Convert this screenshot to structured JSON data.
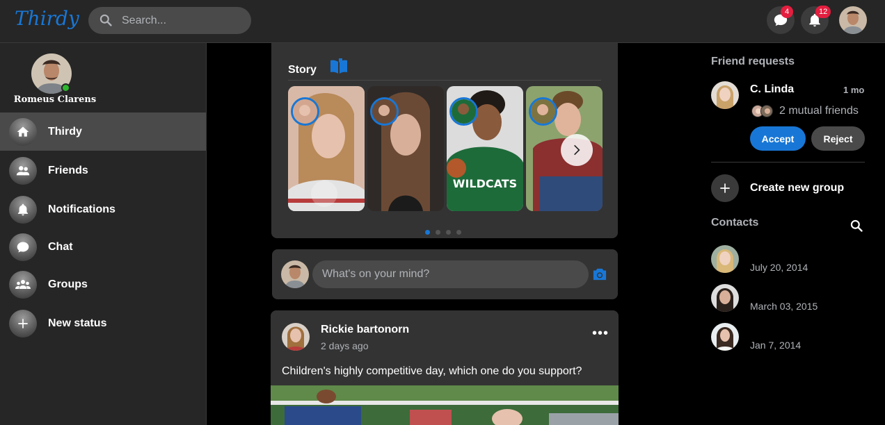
{
  "app": {
    "logo": "Thirdy"
  },
  "search": {
    "placeholder": "Search..."
  },
  "topbar": {
    "messages_badge": "4",
    "notifications_badge": "12"
  },
  "profile": {
    "name": "Romeus Clarens",
    "status": "online"
  },
  "sidebar": {
    "items": [
      {
        "label": "Thirdy",
        "icon": "home-icon",
        "active": true
      },
      {
        "label": "Friends",
        "icon": "friends-icon",
        "active": false
      },
      {
        "label": "Notifications",
        "icon": "bell-icon",
        "active": false
      },
      {
        "label": "Chat",
        "icon": "chat-icon",
        "active": false
      },
      {
        "label": "Groups",
        "icon": "groups-icon",
        "active": false
      },
      {
        "label": "New status",
        "icon": "plus-icon",
        "active": false
      }
    ]
  },
  "story": {
    "title": "Story",
    "pages": 4,
    "active_page": 1
  },
  "compose": {
    "placeholder": "What's on your mind?"
  },
  "post": {
    "author": "Rickie bartonorn",
    "time": "2 days ago",
    "text": "Children's highly competitive day, which one do you support?"
  },
  "friend_requests": {
    "title": "Friend requests",
    "name": "C. Linda",
    "time": "1 mo",
    "mutual": "2 mutual friends",
    "accept_label": "Accept",
    "reject_label": "Reject"
  },
  "create_group": {
    "label": "Create new group"
  },
  "contacts": {
    "title": "Contacts",
    "items": [
      {
        "date": "July 20, 2014"
      },
      {
        "date": "March 03, 2015"
      },
      {
        "date": "Jan 7, 2014"
      }
    ]
  },
  "colors": {
    "accent": "#1877d6",
    "badge": "#e41e3f",
    "online": "#2eb82e",
    "panel": "#262626",
    "card": "#333333"
  }
}
